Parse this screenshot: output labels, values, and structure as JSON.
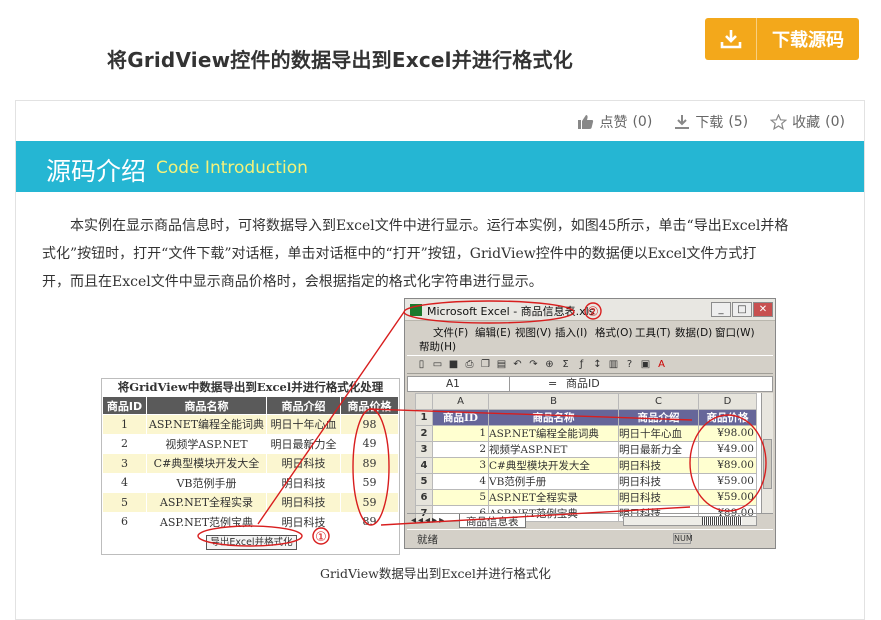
{
  "page": {
    "title": "将GridView控件的数据导出到Excel并进行格式化",
    "download_button": "下载源码"
  },
  "stats": {
    "like_label": "点赞",
    "like_count": "(0)",
    "download_label": "下载",
    "download_count": "(5)",
    "fav_label": "收藏",
    "fav_count": "(0)"
  },
  "section": {
    "title_cn": "源码介绍",
    "title_en": "Code Introduction"
  },
  "paragraph": {
    "line1": "本实例在显示商品信息时，可将数据导入到Excel文件中进行显示。运行本实例，如图45所示，单击“导出Excel并格",
    "line2": "式化”按钮时，打开“文件下载”对话框，单击对话框中的“打开”按钮，GridView控件中的数据便以Excel文件方式打",
    "line3": "开，而且在Excel文件中显示商品价格时，会根据指定的格式化字符串进行显示。"
  },
  "web_grid": {
    "caption": "将GridView中数据导出到Excel并进行格式化处理",
    "headers": [
      "商品ID",
      "商品名称",
      "商品介绍",
      "商品价格"
    ],
    "rows": [
      [
        "1",
        "ASP.NET编程全能词典",
        "明日十年心血",
        "98"
      ],
      [
        "2",
        "视频学ASP.NET",
        "明日最新力全",
        "49"
      ],
      [
        "3",
        "C#典型模块开发大全",
        "明日科技",
        "89"
      ],
      [
        "4",
        "VB范例手册",
        "明日科技",
        "59"
      ],
      [
        "5",
        "ASP.NET全程实录",
        "明日科技",
        "59"
      ],
      [
        "6",
        "ASP.NET范例宝典",
        "明日科技",
        "89"
      ]
    ],
    "export_button": "导出Excel并格式化",
    "marker": "①"
  },
  "excel": {
    "window_title": "Microsoft Excel - 商品信息表.xls",
    "marker": "②",
    "menu_row1": [
      "文件(F)",
      "编辑(E)",
      "视图(V)",
      "插入(I)",
      "格式(O)",
      "工具(T)",
      "数据(D)",
      "窗口(W)"
    ],
    "menu_row2": [
      "帮助(H)"
    ],
    "cell_ref": "A1",
    "formula_value": "商品ID",
    "columns": [
      "A",
      "B",
      "C",
      "D"
    ],
    "header_row": [
      "商品ID",
      "商品名称",
      "商品介绍",
      "商品价格"
    ],
    "rows": [
      [
        "1",
        "ASP.NET编程全能词典",
        "明日十年心血",
        "¥98.00"
      ],
      [
        "2",
        "视频学ASP.NET",
        "明日最新力全",
        "¥49.00"
      ],
      [
        "3",
        "C#典型模块开发大全",
        "明日科技",
        "¥89.00"
      ],
      [
        "4",
        "VB范例手册",
        "明日科技",
        "¥59.00"
      ],
      [
        "5",
        "ASP.NET全程实录",
        "明日科技",
        "¥59.00"
      ],
      [
        "6",
        "ASP.NET范例宝典",
        "明日科技",
        "¥89.00"
      ]
    ],
    "sheet_tab": "商品信息表",
    "status_ready": "就绪",
    "status_num": "NUM"
  },
  "figure_caption": "GridView数据导出到Excel并进行格式化",
  "colors": {
    "accent": "#25b6d3",
    "button": "#f3a81b",
    "annotation": "#d81e1e"
  }
}
